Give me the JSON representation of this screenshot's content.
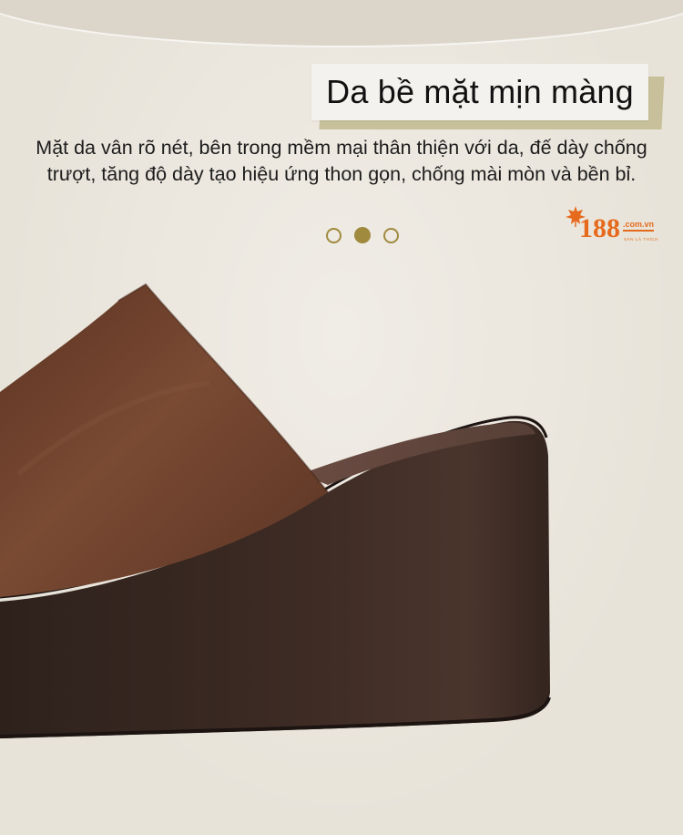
{
  "banner": {
    "title": "Da bề mặt mịn màng",
    "description": "Mặt da vân rõ nét, bên trong mềm mại thân thiện với da, đế dày chống trượt, tăng độ dày tạo hiệu ứng thon gọn, chống mài mòn và bền bỉ."
  },
  "carousel": {
    "slide_count": 3,
    "active_index": 1
  },
  "logo": {
    "number": "188",
    "domain": ".com.vn",
    "tagline": "SĂN LÀ THÍCH",
    "icon": "maple-leaf-icon",
    "color": "#e56a1d"
  },
  "colors": {
    "background": "#e8e3d9",
    "accent": "#a08a3e",
    "leather": "#6b3f2a",
    "sole": "#3b2a24"
  },
  "product": {
    "image": "brown-leather-wedge-slide-sandal"
  }
}
